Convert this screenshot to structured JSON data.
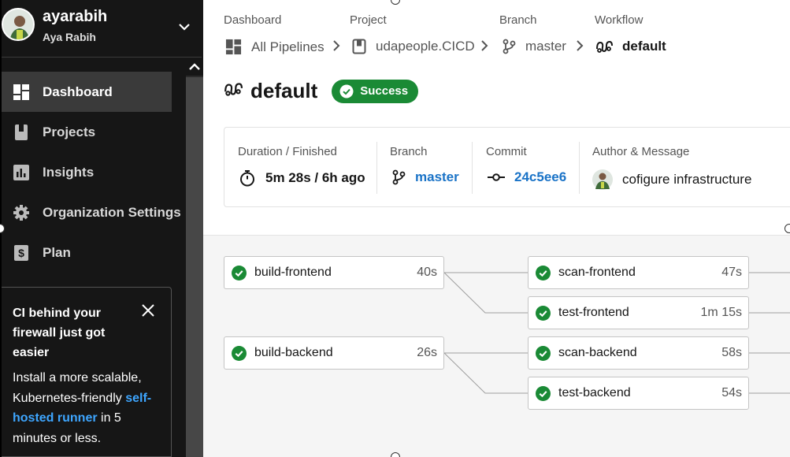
{
  "user": {
    "username": "ayarabih",
    "full_name": "Aya Rabih"
  },
  "nav": [
    {
      "label": "Dashboard",
      "icon": "dashboard-icon",
      "active": true
    },
    {
      "label": "Projects",
      "icon": "projects-icon",
      "active": false
    },
    {
      "label": "Insights",
      "icon": "insights-icon",
      "active": false
    },
    {
      "label": "Organization Settings",
      "icon": "gear-icon",
      "active": false
    },
    {
      "label": "Plan",
      "icon": "dollar-icon",
      "active": false
    }
  ],
  "promo": {
    "title": "CI behind your firewall just got easier",
    "body_before": "Install a more scalable, Kubernetes-friendly",
    "link": "self-hosted runner",
    "body_after": "in 5 minutes or less."
  },
  "breadcrumb": {
    "dashboard_label": "Dashboard",
    "dashboard_value": "All Pipelines",
    "project_label": "Project",
    "project_value": "udapeople.CICD",
    "branch_label": "Branch",
    "branch_value": "master",
    "workflow_label": "Workflow",
    "workflow_value": "default"
  },
  "workflow": {
    "title": "default",
    "status": "Success"
  },
  "meta": {
    "duration_label": "Duration / Finished",
    "duration_value": "5m 28s / 6h ago",
    "branch_label": "Branch",
    "branch_value": "master",
    "commit_label": "Commit",
    "commit_value": "24c5ee6",
    "author_label": "Author & Message",
    "author_message": "cofigure infrastructure"
  },
  "jobs": [
    {
      "name": "build-frontend",
      "time": "40s",
      "status": "success"
    },
    {
      "name": "scan-frontend",
      "time": "47s",
      "status": "success"
    },
    {
      "name": "test-frontend",
      "time": "1m 15s",
      "status": "success"
    },
    {
      "name": "build-backend",
      "time": "26s",
      "status": "success"
    },
    {
      "name": "scan-backend",
      "time": "58s",
      "status": "success"
    },
    {
      "name": "test-backend",
      "time": "54s",
      "status": "success"
    }
  ],
  "colors": {
    "sidebar": "#161616",
    "success": "#1a8a35",
    "link": "#1a73c7",
    "promo_link": "#3ea6ff"
  }
}
